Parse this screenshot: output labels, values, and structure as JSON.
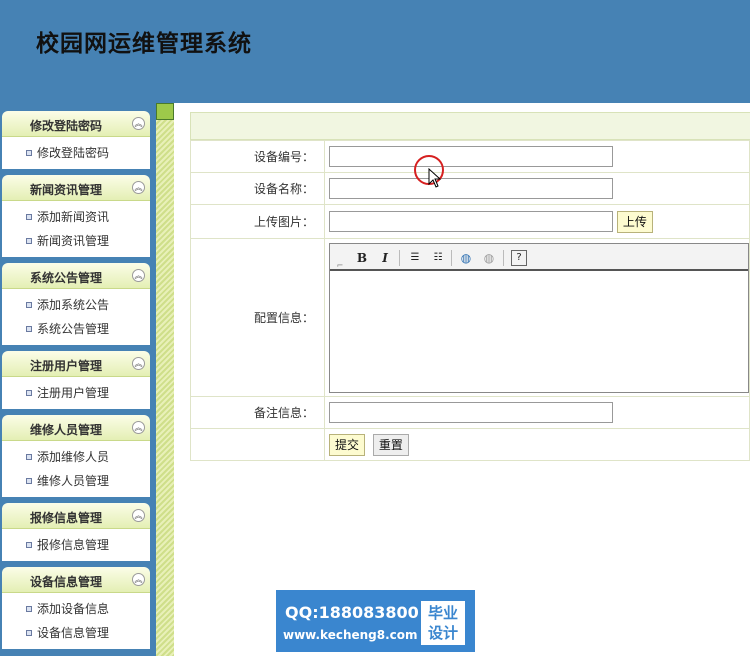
{
  "header": {
    "title": "校园网运维管理系统"
  },
  "sidebar": {
    "groups": [
      {
        "title": "修改登陆密码",
        "items": [
          "修改登陆密码"
        ]
      },
      {
        "title": "新闻资讯管理",
        "items": [
          "添加新闻资讯",
          "新闻资讯管理"
        ]
      },
      {
        "title": "系统公告管理",
        "items": [
          "添加系统公告",
          "系统公告管理"
        ]
      },
      {
        "title": "注册用户管理",
        "items": [
          "注册用户管理"
        ]
      },
      {
        "title": "维修人员管理",
        "items": [
          "添加维修人员",
          "维修人员管理"
        ]
      },
      {
        "title": "报修信息管理",
        "items": [
          "报修信息管理"
        ]
      },
      {
        "title": "设备信息管理",
        "items": [
          "添加设备信息",
          "设备信息管理"
        ]
      }
    ]
  },
  "form": {
    "device_no_label": "设备编号：",
    "device_no_value": "",
    "device_name_label": "设备名称：",
    "device_name_value": "",
    "upload_label": "上传图片：",
    "upload_value": "",
    "upload_button": "上传",
    "config_label": "配置信息：",
    "remark_label": "备注信息：",
    "remark_value": "",
    "submit_button": "提交",
    "reset_button": "重置"
  },
  "editor": {
    "bold": "B",
    "italic": "I"
  },
  "watermark": {
    "qq": "QQ:188083800",
    "url": "www.kecheng8.com",
    "box_line1": "毕业",
    "box_line2": "设计"
  },
  "colors": {
    "header_bg": "#4682b4",
    "watermark_bg": "#3a86cf"
  }
}
